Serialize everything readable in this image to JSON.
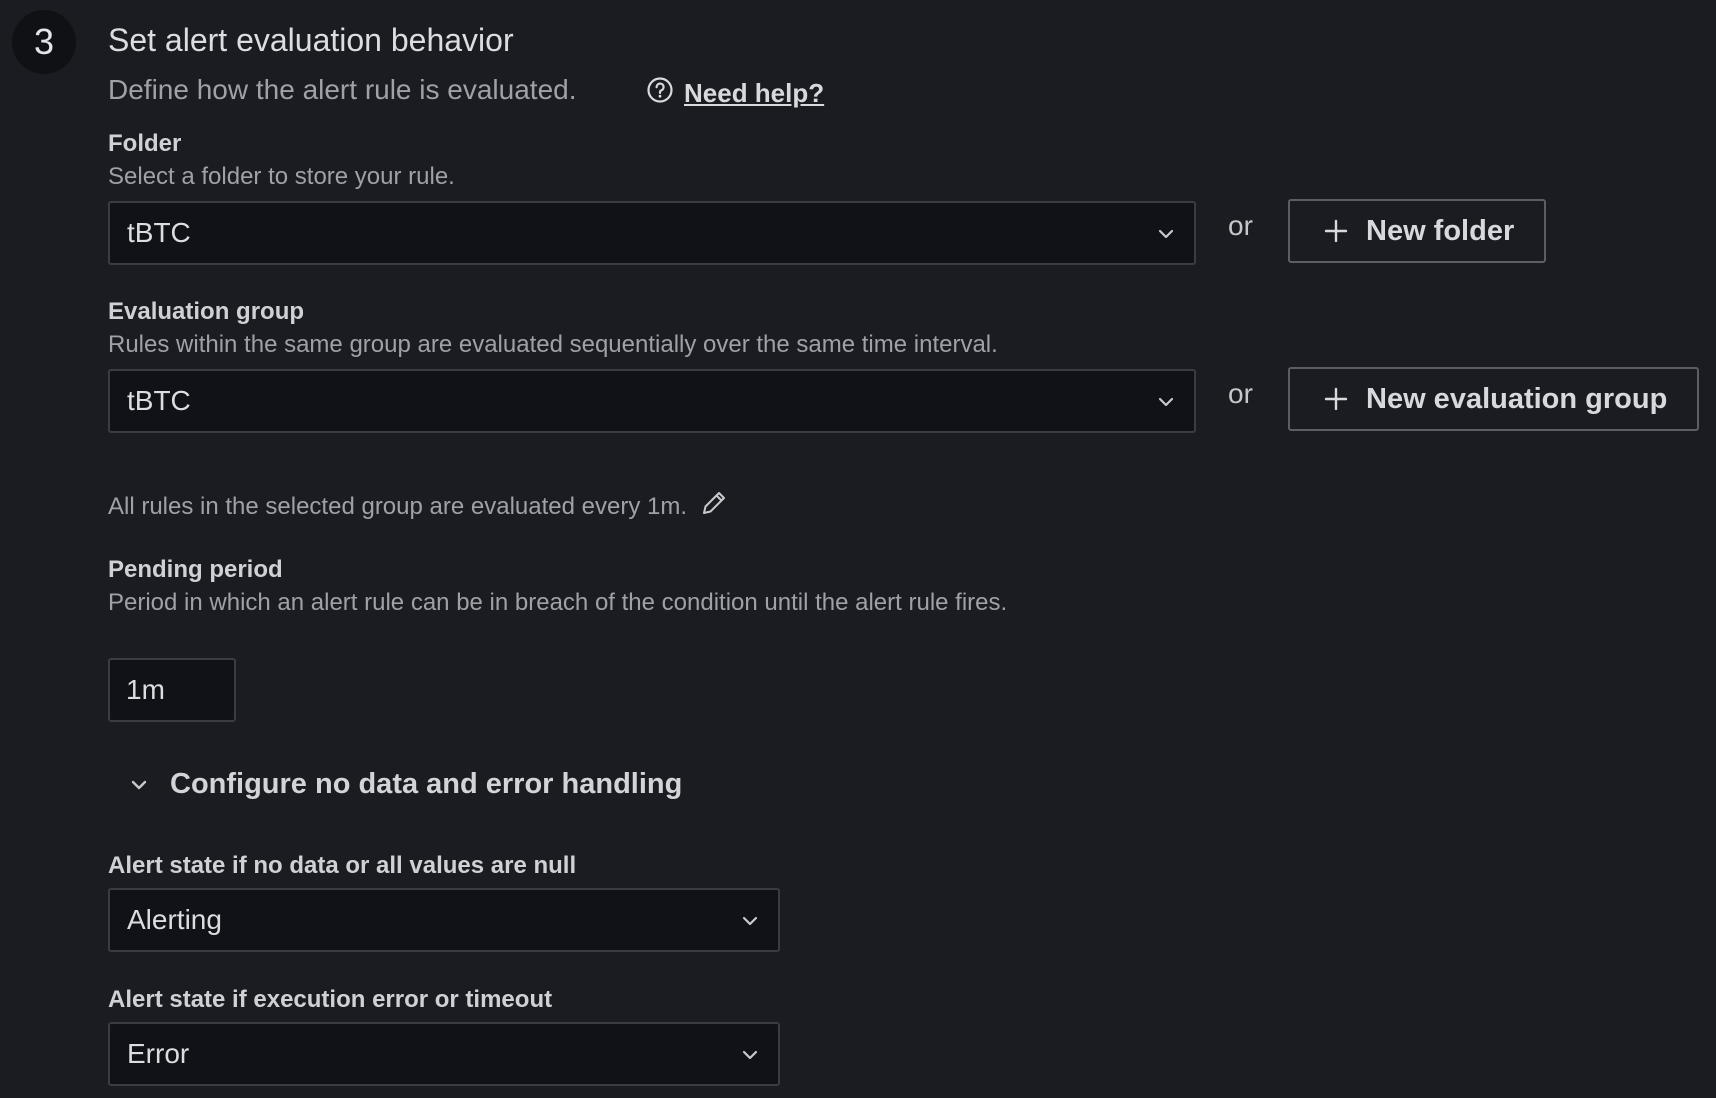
{
  "step": {
    "number": "3",
    "title": "Set alert evaluation behavior",
    "description": "Define how the alert rule is evaluated.",
    "help_link": "Need help?"
  },
  "folder": {
    "label": "Folder",
    "description": "Select a folder to store your rule.",
    "selected": "tBTC",
    "or_text": "or",
    "new_button": "New folder"
  },
  "evaluation_group": {
    "label": "Evaluation group",
    "description": "Rules within the same group are evaluated sequentially over the same time interval.",
    "selected": "tBTC",
    "or_text": "or",
    "new_button": "New evaluation group",
    "interval_note": "All rules in the selected group are evaluated every 1m."
  },
  "pending_period": {
    "label": "Pending period",
    "description": "Period in which an alert rule can be in breach of the condition until the alert rule fires.",
    "value": "1m"
  },
  "no_data_error": {
    "toggle_label": "Configure no data and error handling",
    "no_data": {
      "label": "Alert state if no data or all values are null",
      "selected": "Alerting"
    },
    "exec_error": {
      "label": "Alert state if execution error or timeout",
      "selected": "Error"
    }
  },
  "icons": {
    "help": "question-circle-icon",
    "chevron": "chevron-down-icon",
    "plus": "plus-icon",
    "edit": "pencil-icon"
  }
}
